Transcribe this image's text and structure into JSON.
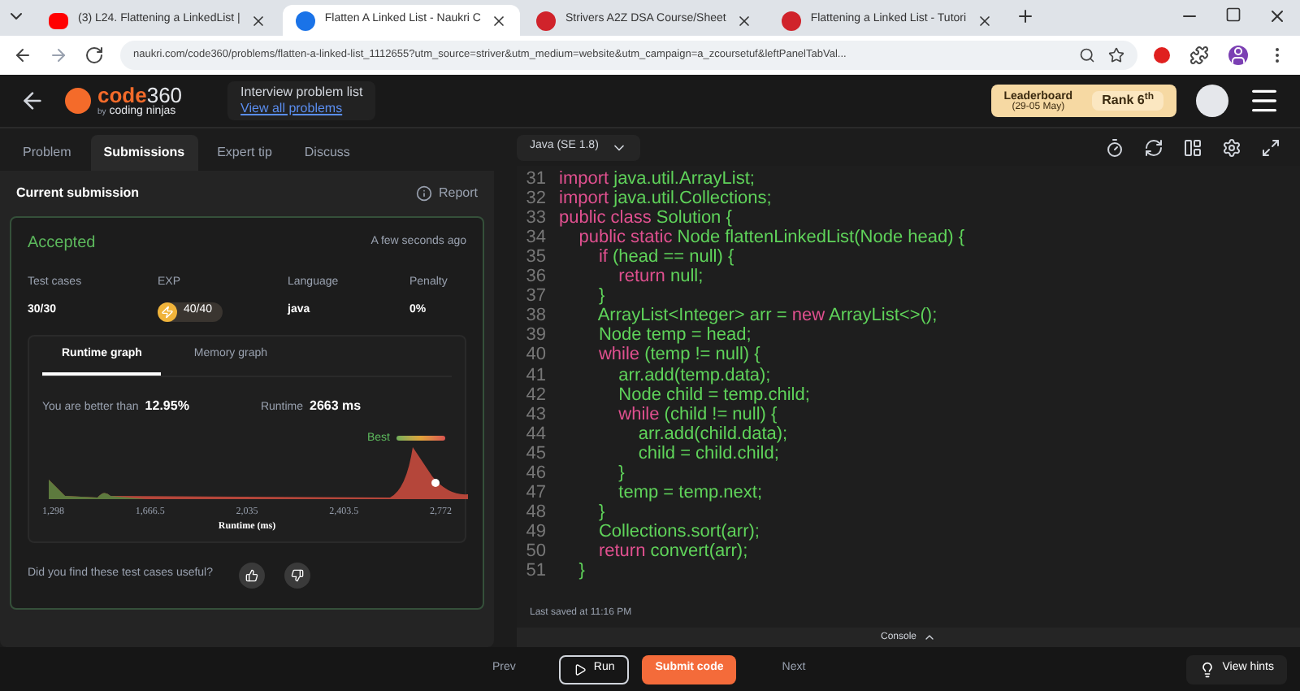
{
  "browser": {
    "tabs": [
      {
        "title": "(3) L24. Flattening a LinkedList |",
        "selected": false,
        "kind": "video"
      },
      {
        "title": "Flatten A Linked List - Naukri C",
        "selected": true,
        "kind": "ninja"
      },
      {
        "title": "Strivers A2Z DSA Course/Sheet",
        "selected": false,
        "kind": "tuf"
      },
      {
        "title": "Flattening a Linked List - Tutori",
        "selected": false,
        "kind": "tuf"
      }
    ],
    "url": "naukri.com/code360/problems/flatten-a-linked-list_1112655?utm_source=striver&utm_medium=website&utm_campaign=a_zcoursetuf&leftPanelTabVal..."
  },
  "header": {
    "logo_main": "code",
    "logo_num": "360",
    "logo_by": "by",
    "logo_brand": "coding ninjas",
    "nav_title": "Interview problem list",
    "nav_link": "View all problems",
    "leaderboard": "Leaderboard",
    "leaderboard_dates": "(29-05 May)",
    "rank": "Rank 6$^{th}$"
  },
  "tabs": [
    {
      "label": "Problem",
      "selected": false
    },
    {
      "label": "Submissions",
      "selected": true
    },
    {
      "label": "Expert tip",
      "selected": false
    },
    {
      "label": "Discuss",
      "selected": false
    }
  ],
  "language": "Java (SE 1.8)",
  "submission": {
    "title": "Current submission",
    "report": "Report",
    "status": "Accepted",
    "time": "A few seconds ago",
    "stats": [
      {
        "label": "Test cases",
        "value": "30/30",
        "kind": "text"
      },
      {
        "label": "EXP",
        "value": "40/40",
        "kind": "badge"
      },
      {
        "label": "Language",
        "value": "java",
        "kind": "text"
      },
      {
        "label": "Penalty",
        "value": "0%",
        "kind": "text"
      }
    ],
    "graph_tabs": [
      {
        "label": "Runtime graph",
        "selected": true
      },
      {
        "label": "Memory graph",
        "selected": false
      }
    ],
    "better_label": "You are better than",
    "better_value": "12.95%",
    "runtime_label": "Runtime",
    "runtime_value": "2663 ms",
    "best_label": "Best",
    "x_labels": [
      "1,298",
      "1,666.5",
      "2,035",
      "2,403.5",
      "2,772"
    ],
    "x_title": "Runtime (ms)",
    "feedback": "Did you find these test cases useful?"
  },
  "code": [
    {
      "number": "31",
      "tokens": [
        {
          "text": "import ",
          "kind": "kw"
        },
        {
          "text": "java.util.ArrayList;",
          "kind": "id"
        }
      ]
    },
    {
      "number": "32",
      "tokens": [
        {
          "text": "import ",
          "kind": "kw"
        },
        {
          "text": "java.util.Collections;",
          "kind": "id"
        }
      ]
    },
    {
      "number": "33",
      "tokens": [
        {
          "text": "public class ",
          "kind": "kw"
        },
        {
          "text": "Solution {",
          "kind": "id"
        }
      ]
    },
    {
      "number": "34",
      "tokens": [
        {
          "text": "    public static ",
          "kind": "kw"
        },
        {
          "text": "Node flattenLinkedList(Node head) {",
          "kind": "id"
        }
      ]
    },
    {
      "number": "35",
      "tokens": [
        {
          "text": "        if ",
          "kind": "kw"
        },
        {
          "text": "(head == null) {",
          "kind": "id"
        }
      ]
    },
    {
      "number": "36",
      "tokens": [
        {
          "text": "            return ",
          "kind": "kw"
        },
        {
          "text": "null;",
          "kind": "id"
        }
      ]
    },
    {
      "number": "37",
      "tokens": [
        {
          "text": "        }",
          "kind": "id"
        }
      ]
    },
    {
      "number": "38",
      "tokens": [
        {
          "text": "        ArrayList<Integer> arr = ",
          "kind": "id"
        },
        {
          "text": "new ",
          "kind": "kw"
        },
        {
          "text": "ArrayList<>();",
          "kind": "id"
        }
      ]
    },
    {
      "number": "39",
      "tokens": [
        {
          "text": "        Node temp = head;",
          "kind": "id"
        }
      ]
    },
    {
      "number": "40",
      "tokens": [
        {
          "text": "        while ",
          "kind": "kw"
        },
        {
          "text": "(temp != null) {",
          "kind": "id"
        }
      ]
    },
    {
      "number": "41",
      "tokens": [
        {
          "text": "            arr.add(temp.data);",
          "kind": "id"
        }
      ]
    },
    {
      "number": "42",
      "tokens": [
        {
          "text": "            Node child = temp.child;",
          "kind": "id"
        }
      ]
    },
    {
      "number": "43",
      "tokens": [
        {
          "text": "            while ",
          "kind": "kw"
        },
        {
          "text": "(child != null) {",
          "kind": "id"
        }
      ]
    },
    {
      "number": "44",
      "tokens": [
        {
          "text": "                arr.add(child.data);",
          "kind": "id"
        }
      ]
    },
    {
      "number": "45",
      "tokens": [
        {
          "text": "                child = child.child;",
          "kind": "id"
        }
      ]
    },
    {
      "number": "46",
      "tokens": [
        {
          "text": "            }",
          "kind": "id"
        }
      ]
    },
    {
      "number": "47",
      "tokens": [
        {
          "text": "            temp = temp.next;",
          "kind": "id"
        }
      ]
    },
    {
      "number": "48",
      "tokens": [
        {
          "text": "        }",
          "kind": "id"
        }
      ]
    },
    {
      "number": "49",
      "tokens": [
        {
          "text": "        Collections.sort(arr);",
          "kind": "id"
        }
      ]
    },
    {
      "number": "50",
      "tokens": [
        {
          "text": "        return ",
          "kind": "kw"
        },
        {
          "text": "convert(arr);",
          "kind": "id"
        }
      ]
    },
    {
      "number": "51",
      "tokens": [
        {
          "text": "    }",
          "kind": "id"
        }
      ]
    }
  ],
  "last_saved": "Last saved at 11:16 PM",
  "console": "Console",
  "footer": {
    "prev": "Prev",
    "run": "Run",
    "submit": "Submit code",
    "next": "Next",
    "hints": "View hints"
  }
}
